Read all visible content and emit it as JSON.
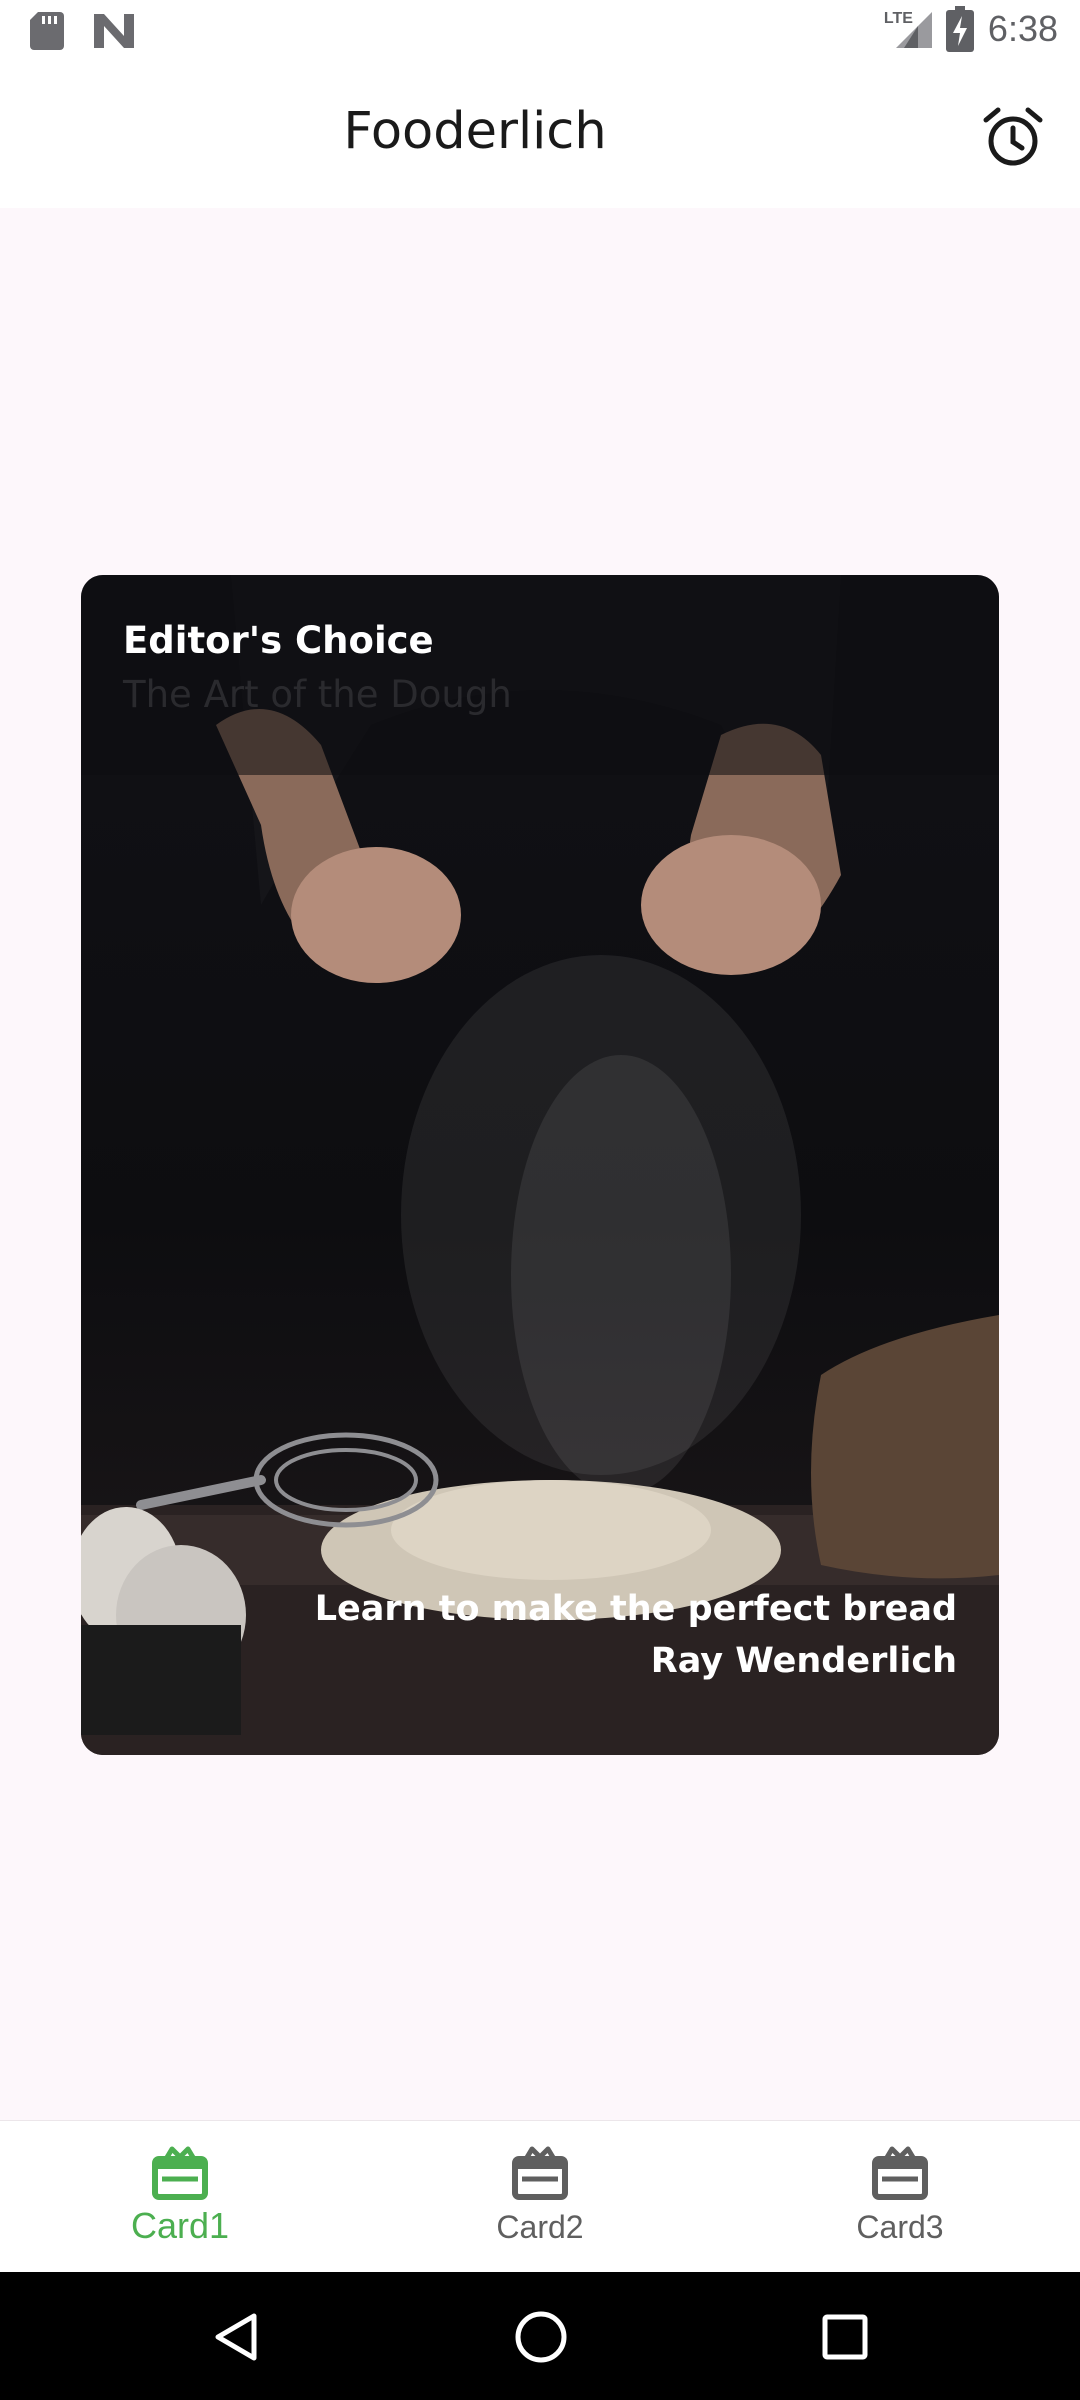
{
  "status_bar": {
    "time": "6:38",
    "network_label": "LTE",
    "icons": [
      "sd-card-icon",
      "n-logo-icon",
      "signal-icon",
      "battery-charging-icon"
    ]
  },
  "app_bar": {
    "title": "Fooderlich",
    "action_icon": "alarm-clock-icon"
  },
  "card": {
    "category": "Editor's Choice",
    "title": "The Art of the Dough",
    "description_line1": "Learn to make the perfect bread",
    "description_line2": "Ray Wenderlich"
  },
  "bottom_nav": {
    "items": [
      {
        "label": "Card1",
        "icon": "card-icon",
        "active": true
      },
      {
        "label": "Card2",
        "icon": "card-icon",
        "active": false
      },
      {
        "label": "Card3",
        "icon": "card-icon",
        "active": false
      }
    ],
    "active_color": "#4caf50",
    "inactive_color": "#5f5f5f"
  },
  "system_nav": {
    "buttons": [
      "back-icon",
      "home-icon",
      "recents-icon"
    ]
  }
}
